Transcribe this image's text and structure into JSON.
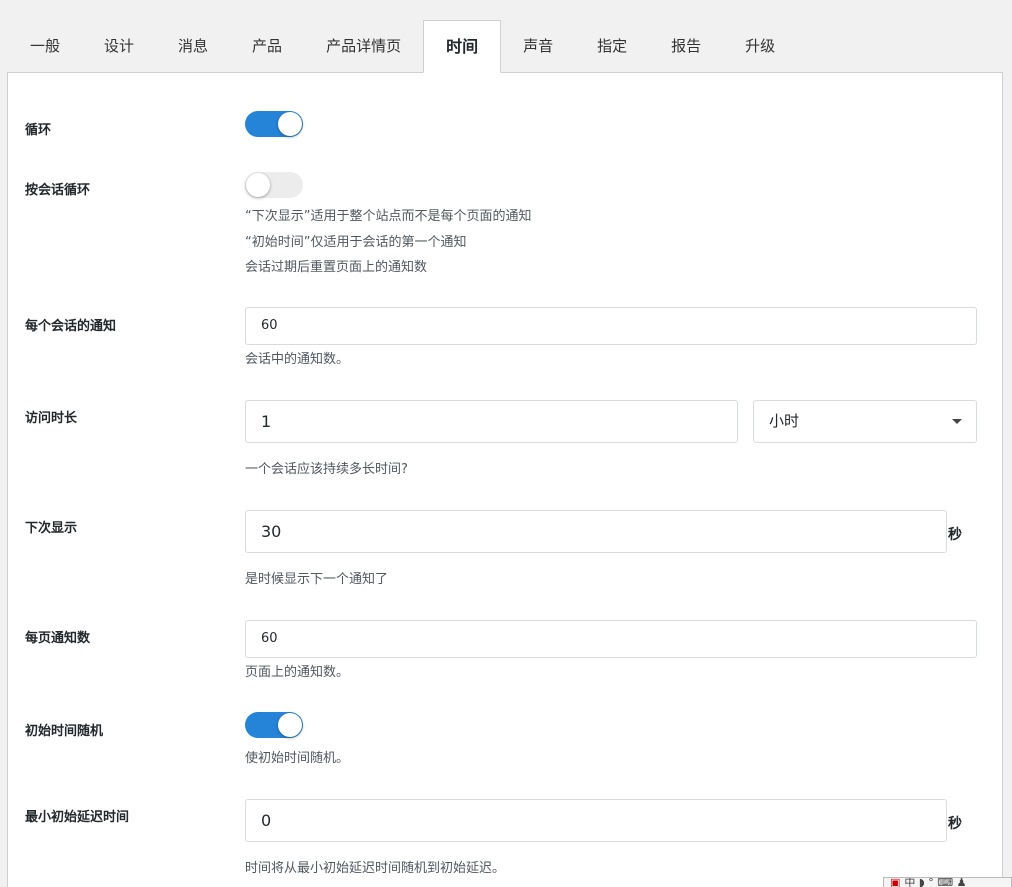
{
  "tabs": [
    {
      "label": "一般",
      "active": false
    },
    {
      "label": "设计",
      "active": false
    },
    {
      "label": "消息",
      "active": false
    },
    {
      "label": "产品",
      "active": false
    },
    {
      "label": "产品详情页",
      "active": false
    },
    {
      "label": "时间",
      "active": true
    },
    {
      "label": "声音",
      "active": false
    },
    {
      "label": "指定",
      "active": false
    },
    {
      "label": "报告",
      "active": false
    },
    {
      "label": "升级",
      "active": false
    }
  ],
  "settings": {
    "loop": {
      "label": "循环",
      "enabled": true
    },
    "session_loop": {
      "label": "按会话循环",
      "enabled": false,
      "desc1": "“下次显示”适用于整个站点而不是每个页面的通知",
      "desc2": "“初始时间”仅适用于会话的第一个通知",
      "desc3": "会话过期后重置页面上的通知数"
    },
    "notifications_per_session": {
      "label": "每个会话的通知",
      "value": "60",
      "desc": "会话中的通知数。"
    },
    "visit_duration": {
      "label": "访问时长",
      "value": "1",
      "unit_selected": "小时",
      "desc": "一个会话应该持续多长时间?"
    },
    "next_display": {
      "label": "下次显示",
      "value": "30",
      "unit": "秒",
      "desc": "是时候显示下一个通知了"
    },
    "per_page": {
      "label": "每页通知数",
      "value": "60",
      "desc": "页面上的通知数。"
    },
    "random_initial": {
      "label": "初始时间随机",
      "enabled": true,
      "desc": "使初始时间随机。"
    },
    "min_initial_delay": {
      "label": "最小初始延迟时间",
      "value": "0",
      "unit": "秒",
      "desc": "时间将从最小初始延迟时间随机到初始延迟。"
    }
  },
  "ime_bar": {
    "text": "中 ◗ ° ⌨ ♟"
  },
  "colors": {
    "accent": "#2684d8",
    "toggle_off": "#ececec"
  }
}
